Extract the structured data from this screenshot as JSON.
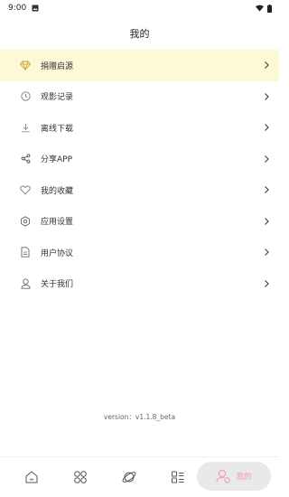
{
  "status_bar": {
    "time": "9:00"
  },
  "header": {
    "title": "我的"
  },
  "menu": [
    {
      "label": "捐赠启源",
      "icon": "diamond-icon",
      "highlighted": true
    },
    {
      "label": "观影记录",
      "icon": "clock-icon"
    },
    {
      "label": "离线下载",
      "icon": "download-icon"
    },
    {
      "label": "分享APP",
      "icon": "share-icon"
    },
    {
      "label": "我的收藏",
      "icon": "heart-icon"
    },
    {
      "label": "应用设置",
      "icon": "settings-icon"
    },
    {
      "label": "用户协议",
      "icon": "document-icon"
    },
    {
      "label": "关于我们",
      "icon": "user-icon"
    }
  ],
  "version": "version：v1.1.8_beta",
  "tabbar": {
    "tabs": [
      "home-icon",
      "apps-icon",
      "planet-icon",
      "list-icon"
    ],
    "active_label": "我的",
    "active_color": "#f29ab7"
  },
  "colors": {
    "highlight_bg": "#fdf8d6",
    "accent": "#f29ab7",
    "icon_gold": "#c9a227"
  }
}
